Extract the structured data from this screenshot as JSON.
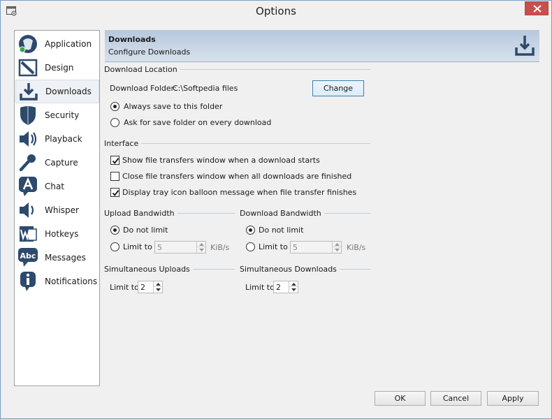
{
  "window": {
    "title": "Options",
    "close_glyph": "✕"
  },
  "sidebar": {
    "items": [
      {
        "label": "Application",
        "icon": "application-icon"
      },
      {
        "label": "Design",
        "icon": "design-icon"
      },
      {
        "label": "Downloads",
        "icon": "downloads-icon",
        "selected": true
      },
      {
        "label": "Security",
        "icon": "shield-icon"
      },
      {
        "label": "Playback",
        "icon": "speaker-icon"
      },
      {
        "label": "Capture",
        "icon": "microphone-icon"
      },
      {
        "label": "Chat",
        "icon": "chat-icon"
      },
      {
        "label": "Whisper",
        "icon": "whisper-icon"
      },
      {
        "label": "Hotkeys",
        "icon": "hotkeys-icon"
      },
      {
        "label": "Messages",
        "icon": "messages-icon"
      },
      {
        "label": "Notifications",
        "icon": "info-icon"
      }
    ]
  },
  "header": {
    "title": "Downloads",
    "subtitle": "Configure Downloads"
  },
  "download_location": {
    "group": "Download Location",
    "folder_label": "Download Folder:",
    "folder_value": "C:\\Softpedia files",
    "change_button": "Change",
    "always_save": {
      "label": "Always save to this folder",
      "checked": true
    },
    "ask_folder": {
      "label": "Ask for save folder on every download",
      "checked": false
    }
  },
  "interface": {
    "group": "Interface",
    "show_window": {
      "label": "Show file transfers window when a download starts",
      "checked": true
    },
    "close_window": {
      "label": "Close file transfers window when all downloads are finished",
      "checked": false
    },
    "tray_balloon": {
      "label": "Display tray icon balloon message when file transfer finishes",
      "checked": true
    }
  },
  "upload_bandwidth": {
    "group": "Upload Bandwidth",
    "no_limit": "Do not limit",
    "limit_to": "Limit to",
    "limit_value": "5",
    "unit": "KiB/s"
  },
  "download_bandwidth": {
    "group": "Download Bandwidth",
    "no_limit": "Do not limit",
    "limit_to": "Limit to",
    "limit_value": "5",
    "unit": "KiB/s"
  },
  "simultaneous_uploads": {
    "group": "Simultaneous Uploads",
    "limit_label": "Limit to",
    "value": "2"
  },
  "simultaneous_downloads": {
    "group": "Simultaneous Downloads",
    "limit_label": "Limit to",
    "value": "2"
  },
  "footer": {
    "ok": "OK",
    "cancel": "Cancel",
    "apply": "Apply"
  },
  "colors": {
    "accent": "#3c7fb1",
    "close": "#c7504c",
    "header_top": "#b7c8dd",
    "icon_blue": "#2d4a6d"
  }
}
